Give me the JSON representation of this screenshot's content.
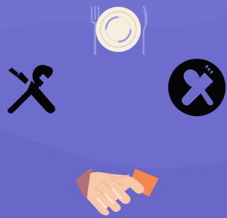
{
  "scene": {
    "background_color": "#6e6ccc",
    "accent_light": "#7b79d6",
    "plate_color": "#f6efe0",
    "cutlery_color": "#9a9ade",
    "tools_color": "#050505",
    "circle_icon_color": "#050505",
    "handshake_sleeve_left": "#b07075",
    "handshake_sleeve_right": "#f2884f",
    "handshake_skin": "#f8c8a8"
  },
  "icons": [
    {
      "name": "dinner-plate-icon"
    },
    {
      "name": "wrench-screwdriver-icon"
    },
    {
      "name": "fork-spoon-circle-icon"
    },
    {
      "name": "handshake-icon"
    }
  ]
}
